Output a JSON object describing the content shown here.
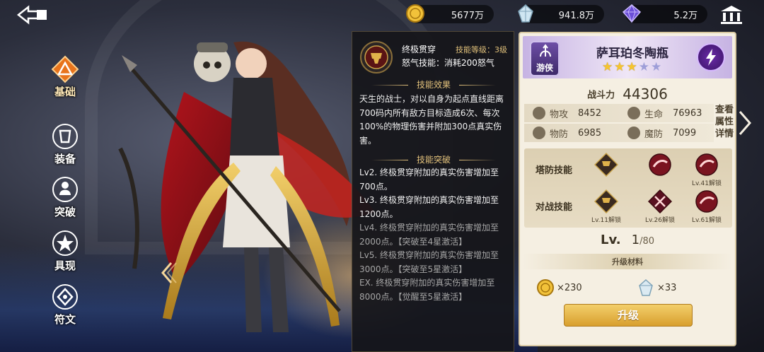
{
  "currencies": {
    "gold": {
      "value": "5677万",
      "icon": "gold-coin-icon"
    },
    "crystal": {
      "value": "941.8万",
      "icon": "crystal-icon"
    },
    "gem": {
      "value": "5.2万",
      "icon": "purple-gem-icon"
    }
  },
  "nav": [
    {
      "label": "基础",
      "icon": "basic-triangle-icon",
      "active": true
    },
    {
      "label": "装备",
      "icon": "equipment-icon",
      "active": false
    },
    {
      "label": "突破",
      "icon": "breakthrough-icon",
      "active": false
    },
    {
      "label": "具现",
      "icon": "manifest-icon",
      "active": false
    },
    {
      "label": "符文",
      "icon": "rune-icon",
      "active": false
    }
  ],
  "skill": {
    "name": "终极贯穿",
    "level_label": "技能等级：3级",
    "type": "怒气技能：消耗200怒气",
    "effect_title": "技能效果",
    "effect_text": "天生的战士，对以自身为起点直线距离700码内所有敌方目标造成6次、每次100%的物理伤害并附加300点真实伤害。",
    "break_title": "技能突破",
    "breaks": [
      {
        "text": "Lv2. 终极贯穿附加的真实伤害增加至700点。",
        "locked": false
      },
      {
        "text": "Lv3. 终极贯穿附加的真实伤害增加至1200点。",
        "locked": false
      },
      {
        "text": "Lv4. 终极贯穿附加的真实伤害增加至2000点。【突破至4星激活】",
        "locked": true
      },
      {
        "text": "Lv5. 终极贯穿附加的真实伤害增加至3000点。【突破至5星激活】",
        "locked": true
      },
      {
        "text": "EX. 终极贯穿附加的真实伤害增加至8000点。【觉醒至5星激活】",
        "locked": true
      }
    ]
  },
  "hero": {
    "name": "萨耳珀冬陶瓶",
    "class_label": "游侠",
    "stars_on": 3,
    "stars_total": 5,
    "power_label": "战斗力",
    "power": "44306",
    "stats": {
      "atk_label": "物攻",
      "atk": "8452",
      "hp_label": "生命",
      "hp": "76963",
      "def_label": "物防",
      "def": "6985",
      "mdef_label": "魔防",
      "mdef": "7099"
    },
    "view_detail": "查看属性详情",
    "skills": {
      "tower_label": "塔防技能",
      "battle_label": "对战技能",
      "tower": [
        {
          "unlock": ""
        },
        {
          "unlock": ""
        },
        {
          "unlock": "Lv.41解锁"
        }
      ],
      "battle": [
        {
          "unlock": "Lv.11解锁"
        },
        {
          "unlock": "Lv.26解锁"
        },
        {
          "unlock": "Lv.61解锁"
        }
      ]
    },
    "level_label": "Lv.",
    "level": "1",
    "level_max": "/80",
    "materials_title": "升级材料",
    "materials": [
      {
        "icon": "gold-coin-icon",
        "count": "×230"
      },
      {
        "icon": "crystal-icon",
        "count": "×33"
      }
    ],
    "upgrade_label": "升级"
  },
  "colors": {
    "gold_accent": "#e3c27c",
    "card_bg": "#f5efe2",
    "button_gold": "#d89f2e",
    "purple": "#6d4ea6"
  }
}
